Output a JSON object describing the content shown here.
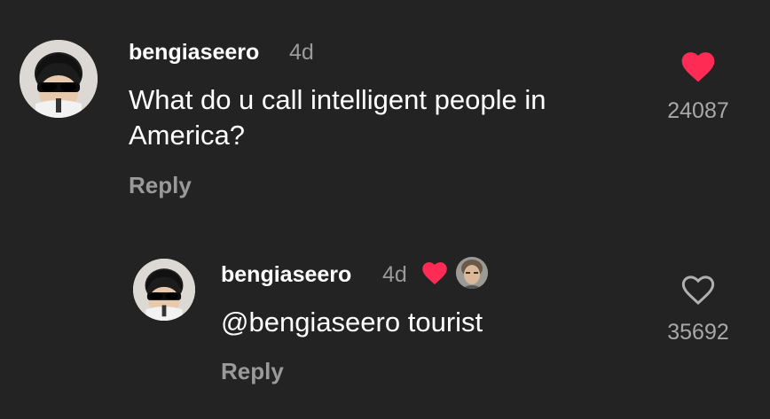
{
  "comments": [
    {
      "username": "bengiaseero",
      "time": "4d",
      "text_line1": "What do u call intelligent people in",
      "text_line2": "America?",
      "reply_label": "Reply",
      "like_count": "24087",
      "liked": true
    },
    {
      "username": "bengiaseero",
      "time": "4d",
      "text": "@bengiaseero tourist",
      "reply_label": "Reply",
      "like_count": "35692",
      "liked": false,
      "liked_by_creator": true
    }
  ],
  "colors": {
    "background": "#232323",
    "heart_red": "#fe2c55",
    "text_primary": "#ffffff",
    "text_secondary": "#9a9a9a"
  }
}
